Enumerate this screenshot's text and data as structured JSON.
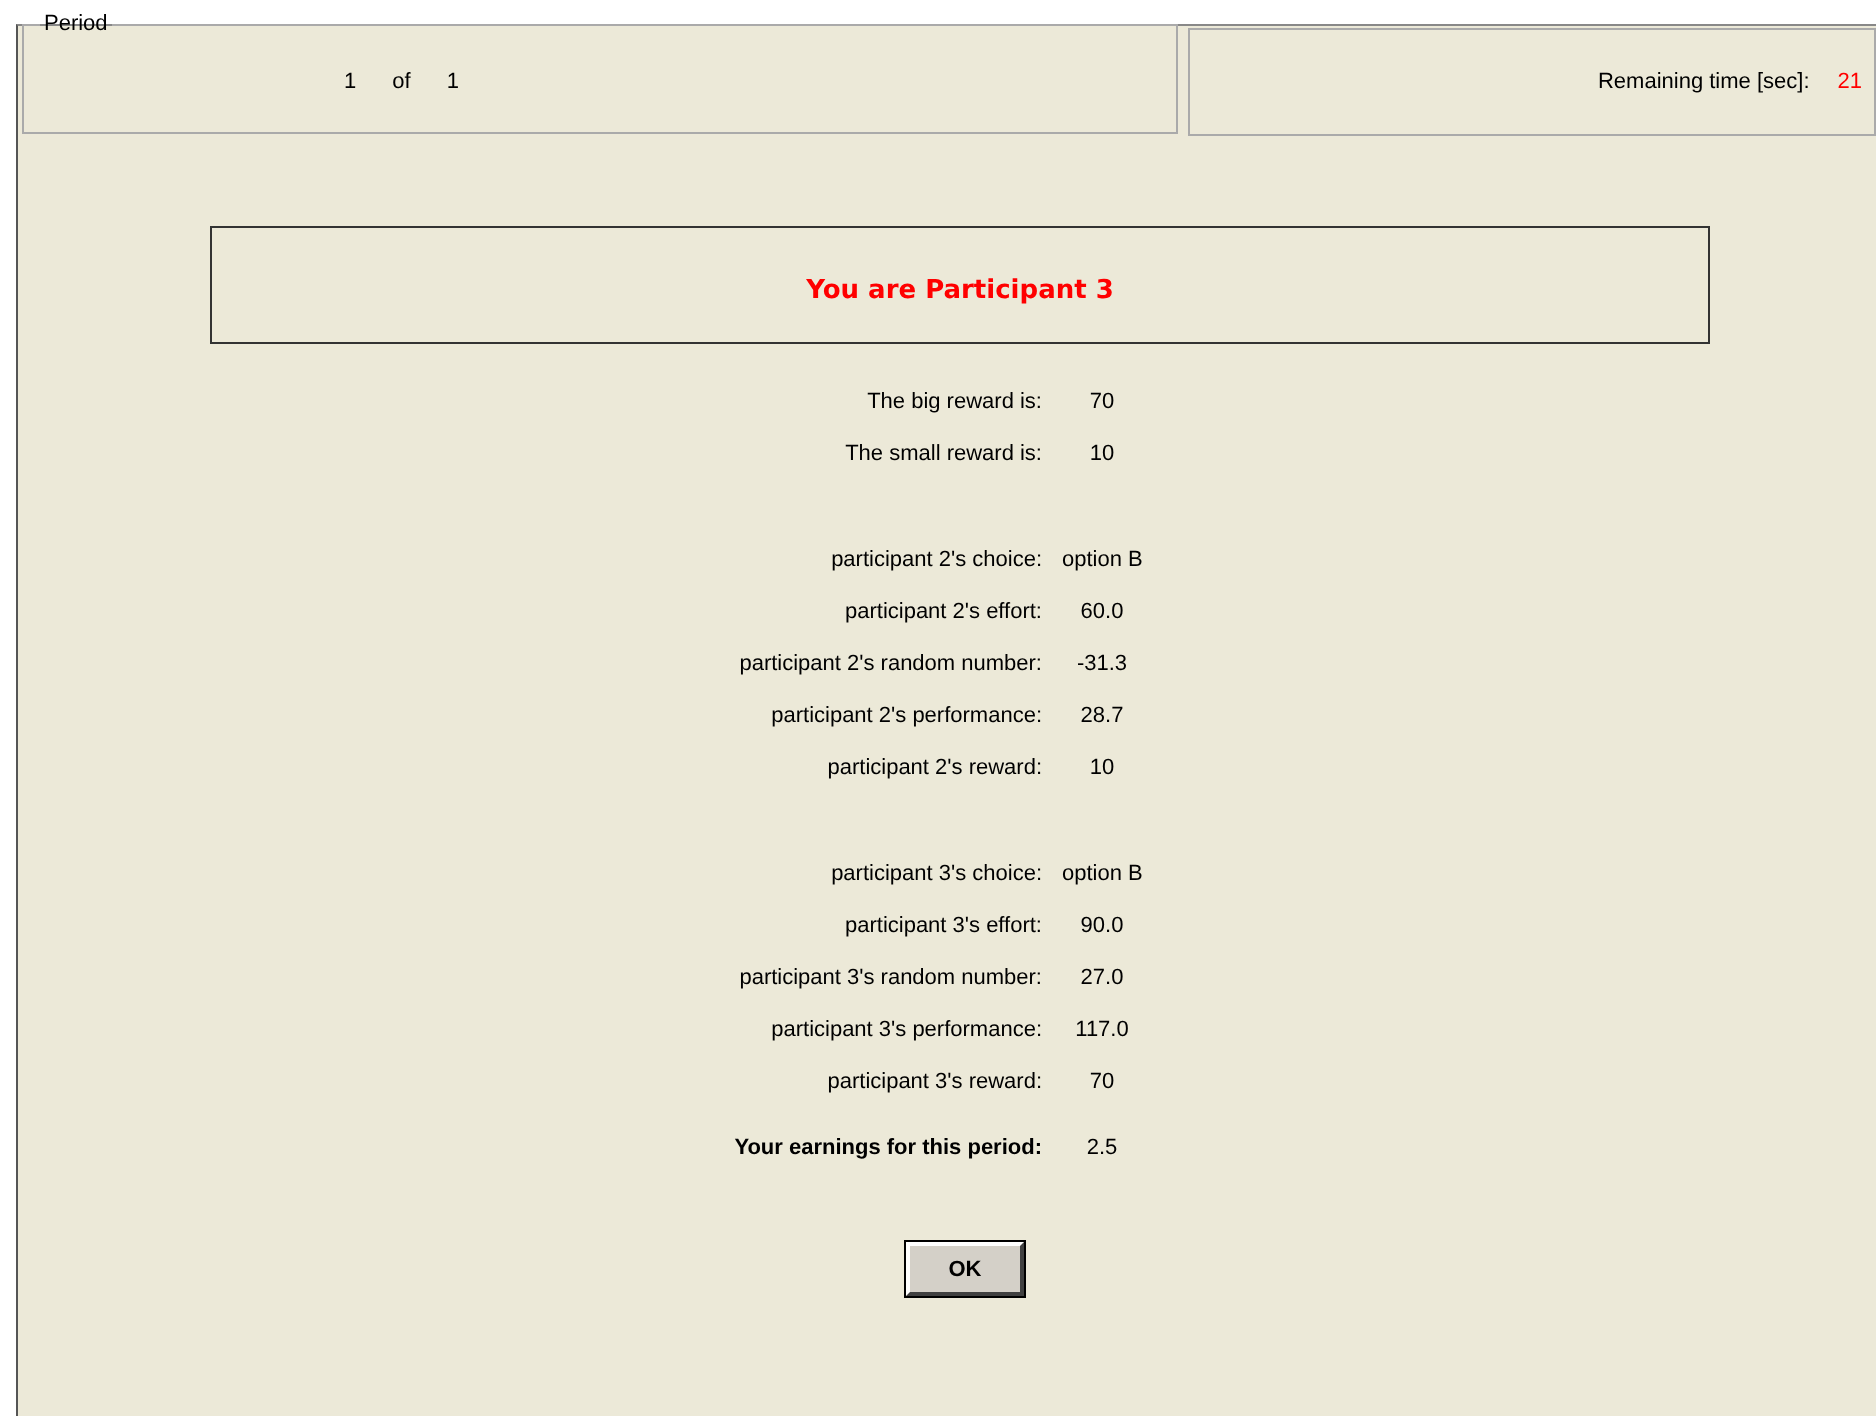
{
  "period_panel": {
    "legend": "Period",
    "current": "1",
    "separator": "of",
    "total": "1"
  },
  "timer_panel": {
    "label": "Remaining time [sec]:",
    "value": "21"
  },
  "banner": {
    "text": "You are Participant 3"
  },
  "groups": [
    [
      {
        "label": "The big reward is:",
        "value": "70"
      },
      {
        "label": "The small reward is:",
        "value": "10"
      }
    ],
    [
      {
        "label": "participant 2's choice:",
        "value": "option B"
      },
      {
        "label": "participant 2's effort:",
        "value": "60.0"
      },
      {
        "label": "participant 2's random number:",
        "value": "-31.3"
      },
      {
        "label": "participant 2's performance:",
        "value": "28.7"
      },
      {
        "label": "participant 2's reward:",
        "value": "10"
      }
    ],
    [
      {
        "label": "participant 3's choice:",
        "value": "option B"
      },
      {
        "label": "participant 3's effort:",
        "value": "90.0"
      },
      {
        "label": "participant 3's random number:",
        "value": "27.0"
      },
      {
        "label": "participant 3's performance:",
        "value": "117.0"
      },
      {
        "label": "participant 3's reward:",
        "value": "70"
      }
    ]
  ],
  "earnings": {
    "label": "Your earnings for this period:",
    "value": "2.5"
  },
  "buttons": [
    "OK"
  ]
}
